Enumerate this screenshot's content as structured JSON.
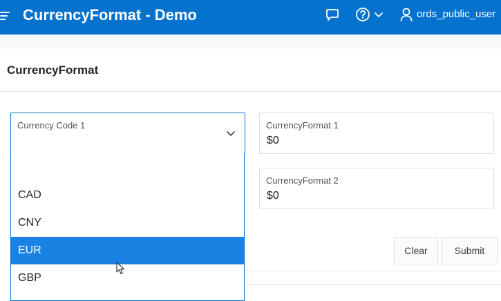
{
  "header": {
    "title": "CurrencyFormat - Demo",
    "user": "ords_public_user",
    "icons": [
      "menu-icon",
      "chat-icon",
      "help-icon",
      "chevron-down-icon",
      "user-icon"
    ],
    "bg_color": "#0572ce"
  },
  "region": {
    "title": "CurrencyFormat"
  },
  "form": {
    "currency_code_1": {
      "label": "Currency Code 1",
      "value": ""
    },
    "currency_format_1": {
      "label": "CurrencyFormat 1",
      "value": "$0"
    },
    "currency_format_2": {
      "label": "CurrencyFormat 2",
      "value": "$0"
    }
  },
  "dropdown": {
    "options": [
      "",
      "CAD",
      "CNY",
      "EUR",
      "GBP"
    ],
    "selected": "EUR",
    "highlight_color": "#1a82e2"
  },
  "buttons": {
    "clear": "Clear",
    "submit": "Submit"
  }
}
